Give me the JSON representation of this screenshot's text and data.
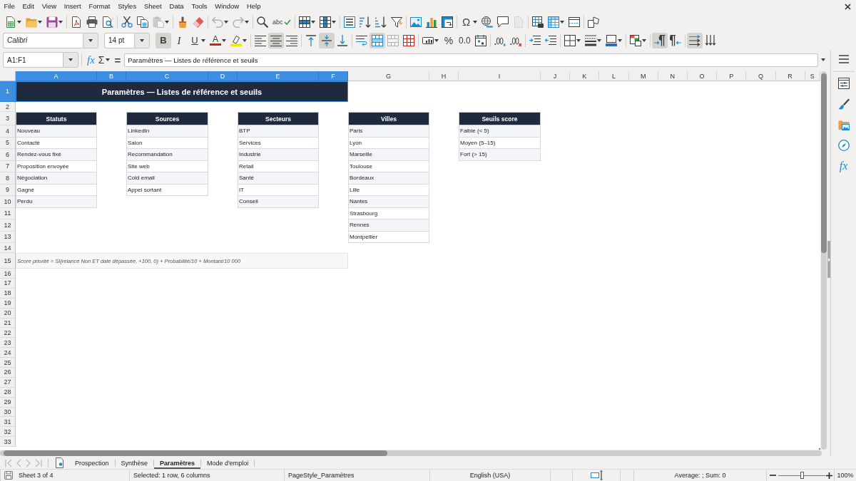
{
  "menu_bar": {
    "items": [
      "File",
      "Edit",
      "View",
      "Insert",
      "Format",
      "Styles",
      "Sheet",
      "Data",
      "Tools",
      "Window",
      "Help"
    ]
  },
  "standard_toolbar": {
    "groups": [
      {
        "buttons": [
          {
            "kind": "new",
            "disabled": false
          },
          {
            "kind": "open",
            "disabled": false
          },
          {
            "kind": "save",
            "disabled": false
          }
        ]
      },
      {
        "buttons": [
          {
            "kind": "pdf",
            "disabled": false
          },
          {
            "kind": "print",
            "disabled": false
          },
          {
            "kind": "preview",
            "disabled": false
          }
        ]
      },
      {
        "buttons": [
          {
            "kind": "cut",
            "disabled": false
          },
          {
            "kind": "copy",
            "disabled": false
          },
          {
            "kind": "paste",
            "disabled": true
          }
        ]
      },
      {
        "buttons": [
          {
            "kind": "clone",
            "disabled": false
          },
          {
            "kind": "clear",
            "disabled": false
          }
        ]
      },
      {
        "buttons": [
          {
            "kind": "undo",
            "disabled": true
          },
          {
            "kind": "redo",
            "disabled": true
          }
        ]
      },
      {
        "buttons": [
          {
            "kind": "find",
            "disabled": false
          },
          {
            "kind": "spelling",
            "label": "abc",
            "disabled": false
          }
        ]
      },
      {
        "buttons": [
          {
            "kind": "row",
            "disabled": false
          },
          {
            "kind": "column",
            "disabled": false
          }
        ]
      },
      {
        "buttons": [
          {
            "kind": "sort",
            "disabled": false
          },
          {
            "kind": "ascending",
            "disabled": false
          },
          {
            "kind": "descending",
            "disabled": false
          },
          {
            "kind": "filter",
            "disabled": false
          }
        ]
      },
      {
        "buttons": [
          {
            "kind": "image",
            "disabled": false
          },
          {
            "kind": "chart",
            "disabled": false
          },
          {
            "kind": "pivot",
            "disabled": false
          }
        ]
      },
      {
        "buttons": [
          {
            "kind": "symbol",
            "label": "Ω",
            "disabled": false
          },
          {
            "kind": "link",
            "disabled": false
          },
          {
            "kind": "comment",
            "disabled": false
          },
          {
            "kind": "header",
            "disabled": true
          }
        ]
      },
      {
        "buttons": [
          {
            "kind": "printarea",
            "disabled": false
          },
          {
            "kind": "freeze",
            "disabled": false
          },
          {
            "kind": "split",
            "disabled": false
          }
        ]
      },
      {
        "buttons": [
          {
            "kind": "draw",
            "disabled": false
          }
        ]
      }
    ]
  },
  "formatting_toolbar": {
    "font_name": "Calibri",
    "font_size": "14 pt",
    "groups": [
      {
        "buttons": [
          {
            "kind": "bold",
            "label": "B",
            "pressed": true,
            "disabled": false
          },
          {
            "kind": "italic",
            "label": "I",
            "pressed": false,
            "disabled": false
          },
          {
            "kind": "underline",
            "label": "U",
            "pressed": false,
            "disabled": false
          },
          {
            "kind": "fontcolor",
            "label": "A",
            "pressed": false,
            "disabled": false
          },
          {
            "kind": "highlight",
            "pressed": false,
            "disabled": false
          }
        ]
      },
      {
        "buttons": [
          {
            "kind": "alignleft",
            "pressed": false,
            "disabled": false
          },
          {
            "kind": "aligncenter",
            "pressed": true,
            "disabled": false
          },
          {
            "kind": "alignright",
            "pressed": false,
            "disabled": false
          }
        ]
      },
      {
        "buttons": [
          {
            "kind": "aligntop",
            "pressed": false,
            "disabled": false
          },
          {
            "kind": "alignmiddle",
            "pressed": true,
            "disabled": false
          },
          {
            "kind": "alignbottom",
            "pressed": false,
            "disabled": false
          }
        ]
      },
      {
        "buttons": [
          {
            "kind": "wrap",
            "pressed": false,
            "disabled": false
          },
          {
            "kind": "mergecenter",
            "pressed": true,
            "disabled": false
          },
          {
            "kind": "merge",
            "pressed": false,
            "disabled": true
          },
          {
            "kind": "unmerge",
            "pressed": false,
            "disabled": false
          }
        ]
      },
      {
        "buttons": [
          {
            "kind": "currency",
            "pressed": false,
            "disabled": false
          },
          {
            "kind": "percent",
            "label": "%",
            "pressed": false,
            "disabled": false
          },
          {
            "kind": "number",
            "label": "0.0",
            "pressed": false,
            "disabled": false
          },
          {
            "kind": "date",
            "pressed": false,
            "disabled": false
          }
        ]
      },
      {
        "buttons": [
          {
            "kind": "adddecimal",
            "pressed": false,
            "disabled": false
          },
          {
            "kind": "deldecimal",
            "pressed": false,
            "disabled": false
          }
        ]
      },
      {
        "buttons": [
          {
            "kind": "indent",
            "pressed": false,
            "disabled": false
          },
          {
            "kind": "outdent",
            "pressed": false,
            "disabled": false
          }
        ]
      },
      {
        "buttons": [
          {
            "kind": "borders",
            "pressed": false,
            "disabled": false
          },
          {
            "kind": "borderstyle",
            "pressed": false,
            "disabled": false
          },
          {
            "kind": "bordercolor",
            "pressed": false,
            "disabled": false
          }
        ]
      },
      {
        "buttons": [
          {
            "kind": "conditional",
            "pressed": false,
            "disabled": false
          }
        ]
      },
      {
        "buttons": [
          {
            "kind": "ltr",
            "pressed": true,
            "disabled": false
          },
          {
            "kind": "rtl",
            "pressed": false,
            "disabled": false
          }
        ]
      },
      {
        "buttons": [
          {
            "kind": "textdir",
            "pressed": true,
            "disabled": false
          },
          {
            "kind": "vertical",
            "pressed": false,
            "disabled": false
          }
        ]
      }
    ]
  },
  "formula_bar": {
    "name_box": "A1:F1",
    "function_wizard": "fx",
    "sum": "Σ",
    "equals": "=",
    "content": "Paramètres — Listes de référence et seuils"
  },
  "columns": [
    {
      "label": "A",
      "selected": true
    },
    {
      "label": "B",
      "selected": true
    },
    {
      "label": "C",
      "selected": true
    },
    {
      "label": "D",
      "selected": true
    },
    {
      "label": "E",
      "selected": true
    },
    {
      "label": "F",
      "selected": true
    },
    {
      "label": "G",
      "selected": false
    },
    {
      "label": "H",
      "selected": false
    },
    {
      "label": "I",
      "selected": false
    },
    {
      "label": "J",
      "selected": false
    },
    {
      "label": "K",
      "selected": false
    },
    {
      "label": "L",
      "selected": false
    },
    {
      "label": "M",
      "selected": false
    },
    {
      "label": "N",
      "selected": false
    },
    {
      "label": "O",
      "selected": false
    },
    {
      "label": "P",
      "selected": false
    },
    {
      "label": "Q",
      "selected": false
    },
    {
      "label": "R",
      "selected": false
    },
    {
      "label": "S",
      "selected": false
    }
  ],
  "rows": [
    {
      "label": "1",
      "selected": true
    },
    {
      "label": "2",
      "selected": false
    },
    {
      "label": "3",
      "selected": false
    },
    {
      "label": "4",
      "selected": false
    },
    {
      "label": "5",
      "selected": false
    },
    {
      "label": "6",
      "selected": false
    },
    {
      "label": "7",
      "selected": false
    },
    {
      "label": "8",
      "selected": false
    },
    {
      "label": "9",
      "selected": false
    },
    {
      "label": "10",
      "selected": false
    },
    {
      "label": "11",
      "selected": false
    },
    {
      "label": "12",
      "selected": false
    },
    {
      "label": "13",
      "selected": false
    },
    {
      "label": "14",
      "selected": false
    },
    {
      "label": "15",
      "selected": false
    },
    {
      "label": "16",
      "selected": false
    },
    {
      "label": "17",
      "selected": false
    },
    {
      "label": "18",
      "selected": false
    },
    {
      "label": "19",
      "selected": false
    },
    {
      "label": "20",
      "selected": false
    },
    {
      "label": "21",
      "selected": false
    },
    {
      "label": "22",
      "selected": false
    },
    {
      "label": "23",
      "selected": false
    },
    {
      "label": "24",
      "selected": false
    },
    {
      "label": "25",
      "selected": false
    },
    {
      "label": "26",
      "selected": false
    },
    {
      "label": "27",
      "selected": false
    },
    {
      "label": "28",
      "selected": false
    },
    {
      "label": "29",
      "selected": false
    },
    {
      "label": "30",
      "selected": false
    },
    {
      "label": "31",
      "selected": false
    },
    {
      "label": "32",
      "selected": false
    },
    {
      "label": "33",
      "selected": false
    }
  ],
  "sheet": {
    "title": {
      "text": "Paramètres — Listes de référence et seuils",
      "selected": true
    },
    "lists": [
      {
        "heading": "Statuts",
        "items": [
          "Nouveau",
          "Contacté",
          "Rendez-vous fixé",
          "Proposition envoyée",
          "Négociation",
          "Gagné",
          "Perdu"
        ]
      },
      {
        "heading": "Sources",
        "items": [
          "LinkedIn",
          "Salon",
          "Recommandation",
          "Site web",
          "Cold email",
          "Appel sortant"
        ]
      },
      {
        "heading": "Secteurs",
        "items": [
          "BTP",
          "Services",
          "Industrie",
          "Retail",
          "Santé",
          "IT",
          "Conseil"
        ]
      },
      {
        "heading": "Villes",
        "items": [
          "Paris",
          "Lyon",
          "Marseille",
          "Toulouse",
          "Bordeaux",
          "Lille",
          "Nantes",
          "Strasbourg",
          "Rennes",
          "Montpellier"
        ]
      },
      {
        "heading": "Seuils score",
        "items": [
          "Faible (< 5)",
          "Moyen (5–15)",
          "Fort (> 15)"
        ]
      }
    ],
    "note": "Score priorité = SI(relance Non ET date dépassée, +100, 0) + Probabilité/10 + Montant/10 000"
  },
  "sidebar": {
    "buttons": [
      {
        "kind": "menu"
      },
      {
        "kind": "properties"
      },
      {
        "kind": "styles"
      },
      {
        "kind": "gallery"
      },
      {
        "kind": "navigator"
      },
      {
        "kind": "functions",
        "label": "fx"
      }
    ]
  },
  "sheet_navigation": [
    {
      "kind": "first",
      "disabled": true
    },
    {
      "kind": "previous",
      "disabled": true
    },
    {
      "kind": "next",
      "disabled": true
    },
    {
      "kind": "last",
      "disabled": true
    }
  ],
  "sheet_tabs": [
    {
      "label": "Prospection",
      "selected": false
    },
    {
      "label": "Synthèse",
      "selected": false
    },
    {
      "label": "Paramètres",
      "selected": true
    },
    {
      "label": "Mode d'emploi",
      "selected": false
    }
  ],
  "status_bar": {
    "sheet_position": "Sheet 3 of 4",
    "selection": "Selected: 1 row, 6 columns",
    "page_style": "PageStyle_Paramètres",
    "language": "English (USA)",
    "summary": "Average: ; Sum: 0",
    "zoom_slider": {
      "level": 0.5
    },
    "zoom": "100%"
  }
}
